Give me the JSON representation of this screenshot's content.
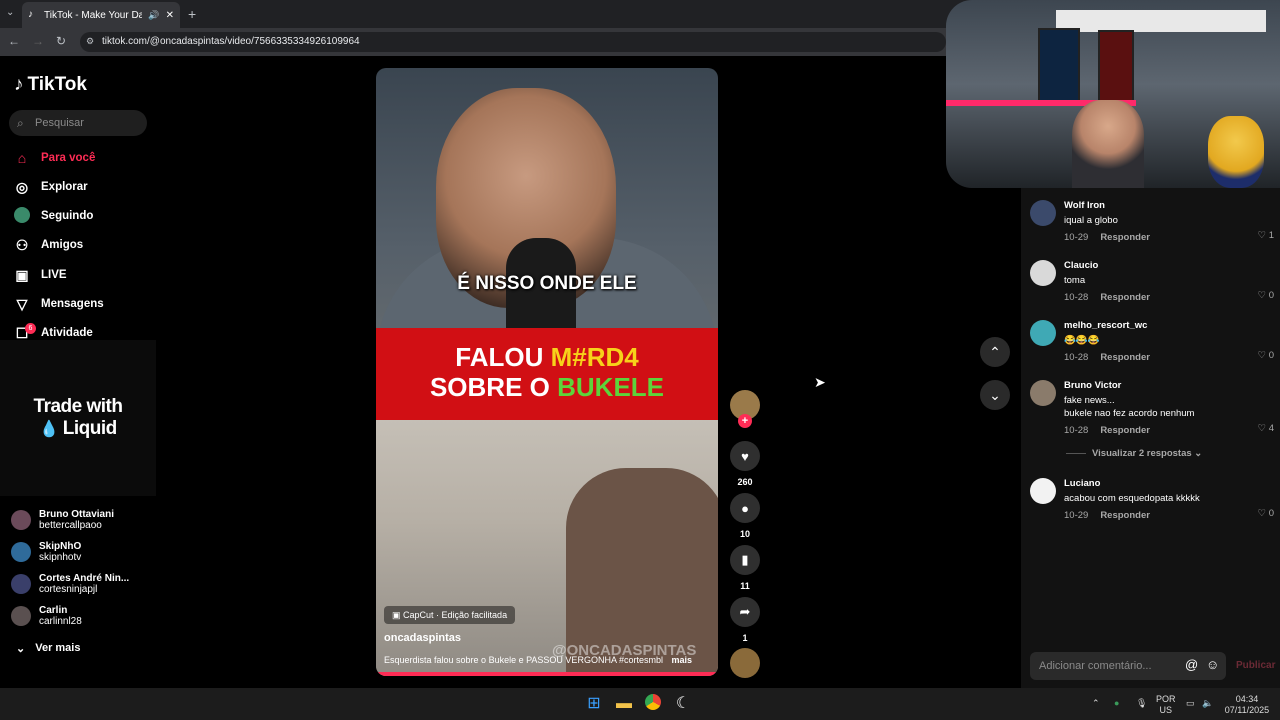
{
  "browser": {
    "tab_title": "TikTok - Make Your Day",
    "url": "tiktok.com/@oncadaspintas/video/7566335334926109964"
  },
  "sidebar": {
    "logo": "TikTok",
    "search_placeholder": "Pesquisar",
    "nav": [
      {
        "label": "Para você",
        "icon": "home-icon",
        "active": true
      },
      {
        "label": "Explorar",
        "icon": "compass-icon"
      },
      {
        "label": "Seguindo",
        "icon": "following-icon"
      },
      {
        "label": "Amigos",
        "icon": "friends-icon"
      },
      {
        "label": "LIVE",
        "icon": "live-icon"
      },
      {
        "label": "Mensagens",
        "icon": "messages-icon"
      },
      {
        "label": "Atividade",
        "icon": "activity-icon",
        "badge": "6"
      }
    ],
    "ad": {
      "line1": "Trade with",
      "line2": "Liquid"
    },
    "following_accounts": [
      {
        "name": "Bruno Ottaviani",
        "handle": "bettercallpaoo"
      },
      {
        "name": "SkipNhO",
        "handle": "skipnhotv"
      },
      {
        "name": "Cortes André Nin...",
        "handle": "cortesninjapjl"
      },
      {
        "name": "Carlin",
        "handle": "carlinnl28"
      }
    ],
    "see_more": "Ver mais"
  },
  "video": {
    "caption_top": "É NISSO ONDE ELE",
    "headline_line1_a": "FALOU ",
    "headline_line1_b": "M#RD4",
    "headline_line2_a": "SOBRE O ",
    "headline_line2_b": "BUKELE",
    "capcut_badge": "CapCut · Edição facilitada",
    "username": "oncadaspintas",
    "description": "Esquerdista falou sobre o Bukele e PASSOU VERGONHA #cortesmbl",
    "more": "mais",
    "watermark": "@ONCADASPINTAS",
    "likes": "260",
    "comments": "10",
    "saves": "11",
    "shares": "1"
  },
  "comments": [
    {
      "user": "Wolf Iron",
      "text": "iqual a globo",
      "date": "10-29",
      "likes": "1",
      "avatar": "#3b4a6b"
    },
    {
      "user": "Claucio",
      "text": "toma",
      "date": "10-28",
      "likes": "0",
      "avatar": "#d9d9d9"
    },
    {
      "user": "melho_rescort_wc",
      "text": "😂😂😂",
      "date": "10-28",
      "likes": "0",
      "avatar": "#3fa9b5"
    },
    {
      "user": "Bruno Victor",
      "text": "fake news...",
      "text2": "bukele nao fez acordo nenhum",
      "date": "10-28",
      "likes": "4",
      "avatar": "#8a7b6b"
    },
    {
      "user": "Luciano",
      "text": "acabou com esquedopata kkkkk",
      "date": "10-29",
      "likes": "0",
      "avatar": "#f2f2f2"
    }
  ],
  "reply_label": "Responder",
  "view_replies": "Visualizar 2 respostas",
  "comment_box": {
    "placeholder": "Adicionar comentário...",
    "publish": "Publicar"
  },
  "taskbar": {
    "lang1": "POR",
    "lang2": "US",
    "time": "04:34",
    "date": "07/11/2025"
  },
  "colors": {
    "accent": "#fe2c55",
    "background": "#000000",
    "panel": "#121212"
  }
}
